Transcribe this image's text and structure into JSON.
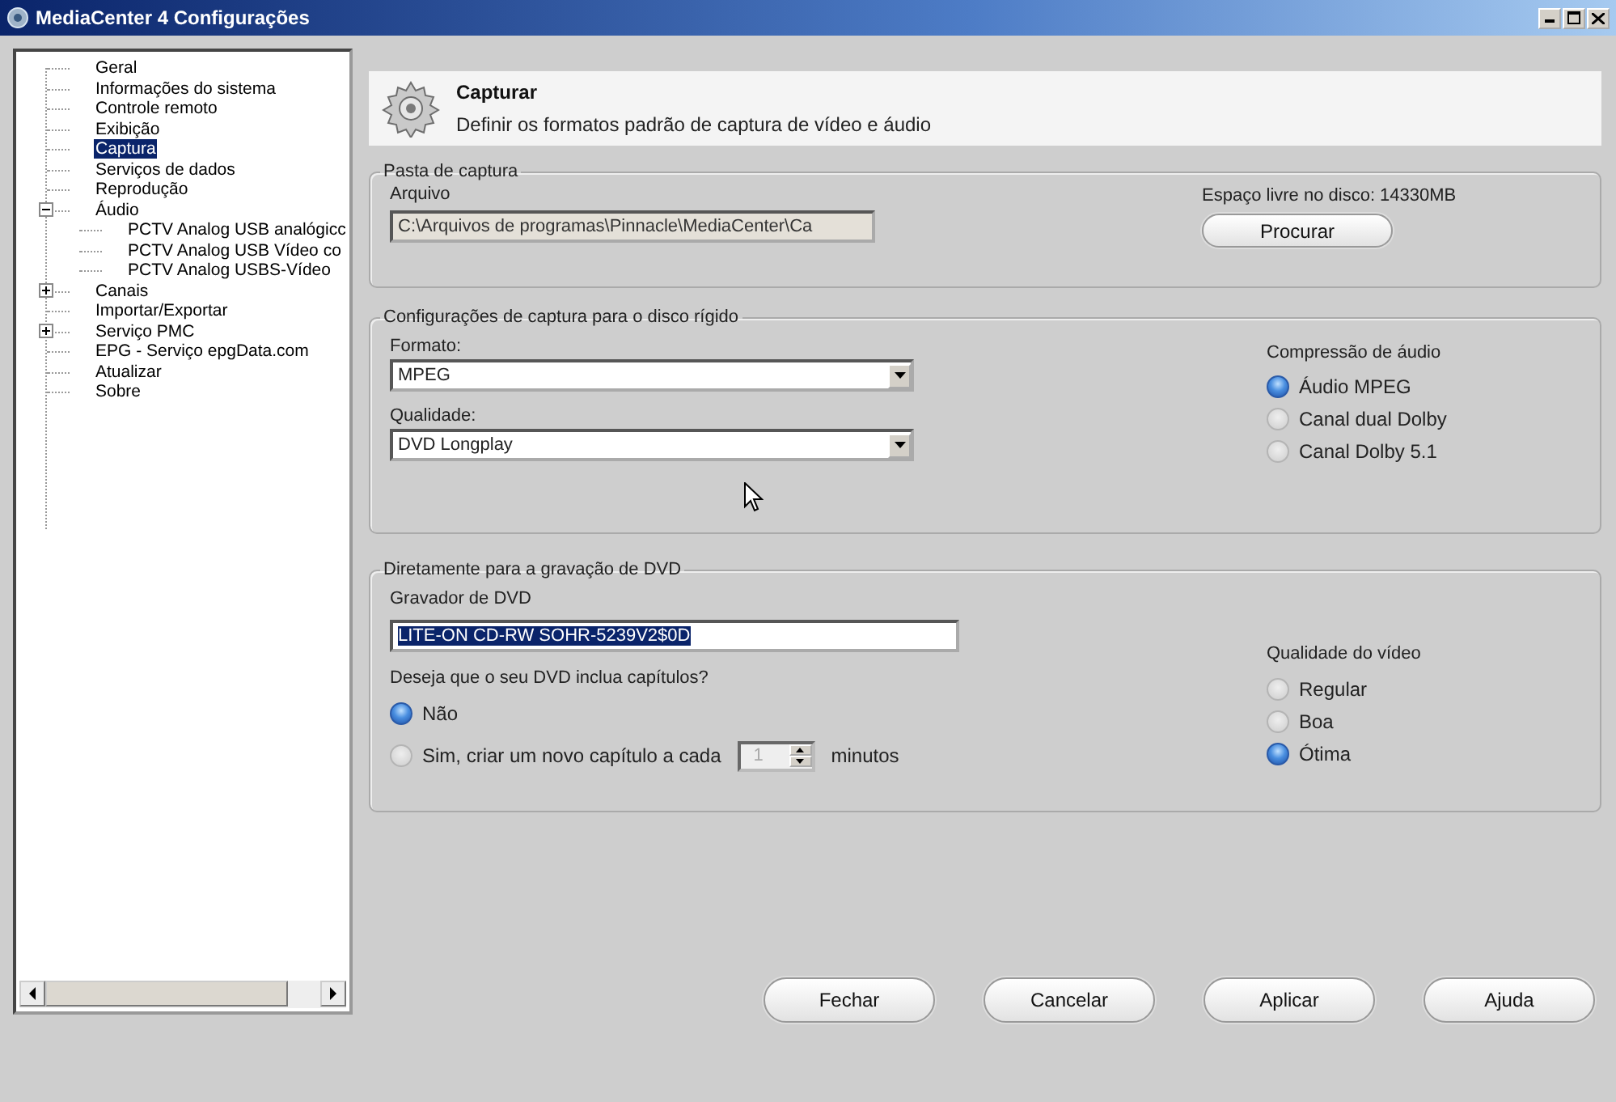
{
  "window": {
    "title": "MediaCenter 4 Configurações"
  },
  "sidebar": {
    "items": [
      {
        "label": "Geral",
        "selected": false
      },
      {
        "label": "Informações do sistema",
        "selected": false
      },
      {
        "label": "Controle remoto",
        "selected": false
      },
      {
        "label": "Exibição",
        "selected": false
      },
      {
        "label": "Captura",
        "selected": true
      },
      {
        "label": "Serviços de dados",
        "selected": false
      },
      {
        "label": "Reprodução",
        "selected": false
      },
      {
        "label": "Áudio",
        "selected": false,
        "expanded": true,
        "children": [
          {
            "label": "PCTV Analog USB analógicc",
            "selected": false
          },
          {
            "label": "PCTV Analog USB Vídeo co",
            "selected": false
          },
          {
            "label": "PCTV Analog USBS-Vídeo",
            "selected": false
          }
        ]
      },
      {
        "label": "Canais",
        "selected": false,
        "expanded": false
      },
      {
        "label": "Importar/Exportar",
        "selected": false
      },
      {
        "label": "Serviço PMC",
        "selected": false,
        "expanded": false
      },
      {
        "label": "EPG - Serviço epgData.com",
        "selected": false
      },
      {
        "label": "Atualizar",
        "selected": false
      },
      {
        "label": "Sobre",
        "selected": false
      }
    ]
  },
  "header": {
    "title": "Capturar",
    "subtitle": "Definir os formatos padrão de captura de vídeo e áudio"
  },
  "capture_folder": {
    "legend": "Pasta de captura",
    "label": "Arquivo",
    "value": "C:\\Arquivos de programas\\Pinnacle\\MediaCenter\\Ca",
    "free_space": "Espaço livre no disco: 14330MB",
    "browse_button": "Procurar"
  },
  "hard_disk": {
    "legend": "Configurações de captura para o disco rígido",
    "format_label": "Formato:",
    "format_value": "MPEG",
    "quality_label": "Qualidade:",
    "quality_value": "DVD Longplay",
    "audio_label": "Compressão de áudio",
    "audio_options": [
      {
        "label": "Áudio MPEG",
        "selected": true
      },
      {
        "label": "Canal dual Dolby",
        "selected": false
      },
      {
        "label": "Canal Dolby 5.1",
        "selected": false
      }
    ]
  },
  "dvd": {
    "legend": "Diretamente para a gravação de DVD",
    "recorder_label": "Gravador de DVD",
    "recorder_value": "LITE-ON CD-RW SOHR-5239V2$0D",
    "recorder_text_selected": true,
    "chapters_question": "Deseja que o seu DVD inclua capítulos?",
    "chapter_options": [
      {
        "label": "Não",
        "selected": true
      },
      {
        "label": "Sim, criar um novo capítulo a cada",
        "selected": false
      }
    ],
    "interval": {
      "value": "1",
      "disabled": true
    },
    "interval_unit": "minutos",
    "video_label": "Qualidade do vídeo",
    "video_options": [
      {
        "label": "Regular",
        "selected": false
      },
      {
        "label": "Boa",
        "selected": false
      },
      {
        "label": "Ótima",
        "selected": true
      }
    ]
  },
  "buttons": [
    "Fechar",
    "Cancelar",
    "Aplicar",
    "Ajuda"
  ]
}
